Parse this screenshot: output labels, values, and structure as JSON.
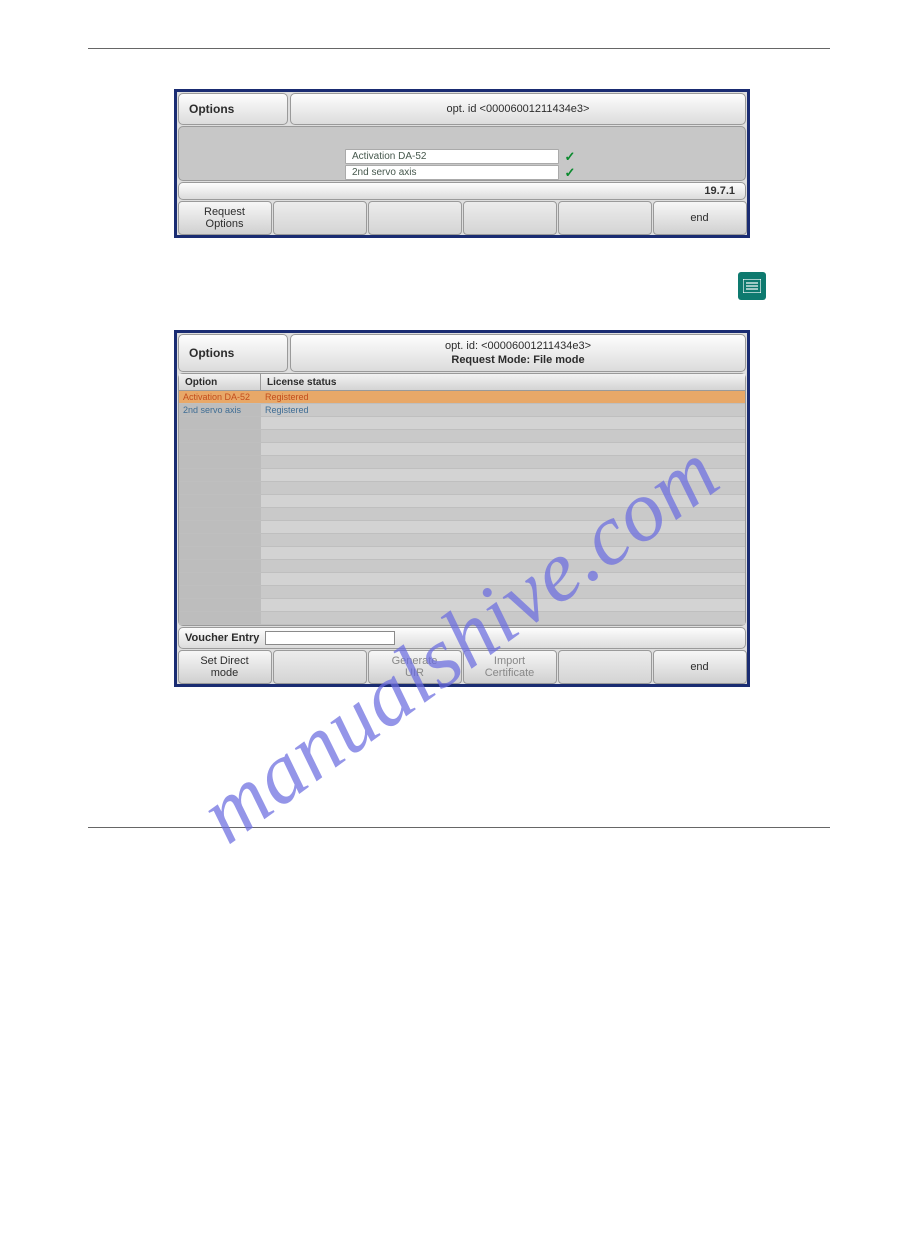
{
  "watermark": "manualshive.com",
  "figure1": {
    "title": "Options",
    "info_line1": "opt. id <00006001211434e3>",
    "options": [
      {
        "name": "Activation DA-52",
        "checked": true
      },
      {
        "name": "2nd servo axis",
        "checked": true
      }
    ],
    "status": "19.7.1",
    "buttons": {
      "b1": "Request\nOptions",
      "b6": "end"
    }
  },
  "figure2": {
    "title": "Options",
    "info_line1": "opt. id: <00006001211434e3>",
    "info_line2": "Request Mode: File mode",
    "columns": {
      "c1": "Option",
      "c2": "License status"
    },
    "rows": [
      {
        "option": "Activation DA-52",
        "status": "Registered",
        "selected": true
      },
      {
        "option": "2nd servo axis",
        "status": "Registered",
        "selected": false
      }
    ],
    "voucher_label": "Voucher Entry",
    "buttons": {
      "b1": "Set Direct\nmode",
      "b3": "Generate\nUIR",
      "b4": "Import\nCertificate",
      "b6": "end"
    }
  }
}
